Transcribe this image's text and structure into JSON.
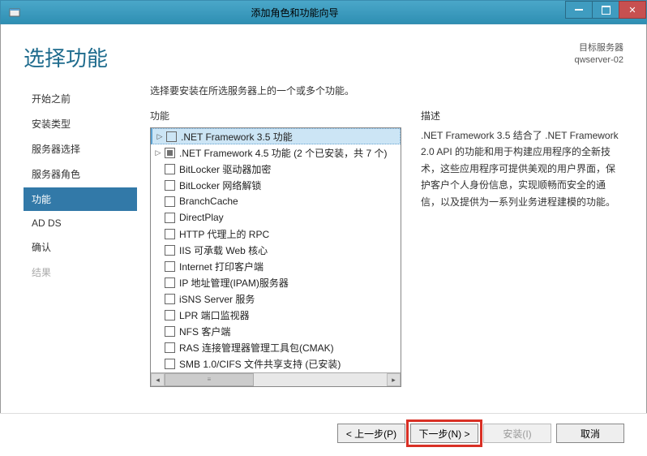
{
  "titlebar": {
    "title": "添加角色和功能向导"
  },
  "header": {
    "page_title": "选择功能",
    "server_label": "目标服务器",
    "server_name": "qwserver-02"
  },
  "nav": {
    "items": [
      {
        "label": "开始之前",
        "state": "normal"
      },
      {
        "label": "安装类型",
        "state": "normal"
      },
      {
        "label": "服务器选择",
        "state": "normal"
      },
      {
        "label": "服务器角色",
        "state": "normal"
      },
      {
        "label": "功能",
        "state": "active"
      },
      {
        "label": "AD DS",
        "state": "normal"
      },
      {
        "label": "确认",
        "state": "normal"
      },
      {
        "label": "结果",
        "state": "disabled"
      }
    ]
  },
  "instruction": "选择要安装在所选服务器上的一个或多个功能。",
  "features_label": "功能",
  "desc_label": "描述",
  "features": [
    {
      "label": ".NET Framework 3.5 功能",
      "expander": "▷",
      "checked": "none",
      "selected": true
    },
    {
      "label": ".NET Framework 4.5 功能 (2 个已安装，共 7 个)",
      "expander": "▷",
      "checked": "partial",
      "selected": false
    },
    {
      "label": "BitLocker 驱动器加密",
      "expander": "",
      "checked": "none",
      "selected": false
    },
    {
      "label": "BitLocker 网络解锁",
      "expander": "",
      "checked": "none",
      "selected": false
    },
    {
      "label": "BranchCache",
      "expander": "",
      "checked": "none",
      "selected": false
    },
    {
      "label": "DirectPlay",
      "expander": "",
      "checked": "none",
      "selected": false
    },
    {
      "label": "HTTP 代理上的 RPC",
      "expander": "",
      "checked": "none",
      "selected": false
    },
    {
      "label": "IIS 可承载 Web 核心",
      "expander": "",
      "checked": "none",
      "selected": false
    },
    {
      "label": "Internet 打印客户端",
      "expander": "",
      "checked": "none",
      "selected": false
    },
    {
      "label": "IP 地址管理(IPAM)服务器",
      "expander": "",
      "checked": "none",
      "selected": false
    },
    {
      "label": "iSNS Server 服务",
      "expander": "",
      "checked": "none",
      "selected": false
    },
    {
      "label": "LPR 端口监视器",
      "expander": "",
      "checked": "none",
      "selected": false
    },
    {
      "label": "NFS 客户端",
      "expander": "",
      "checked": "none",
      "selected": false
    },
    {
      "label": "RAS 连接管理器管理工具包(CMAK)",
      "expander": "",
      "checked": "none",
      "selected": false
    },
    {
      "label": "SMB 1.0/CIFS 文件共享支持 (已安装)",
      "expander": "",
      "checked": "none",
      "selected": false
    }
  ],
  "description": ".NET Framework 3.5 结合了 .NET Framework 2.0 API 的功能和用于构建应用程序的全新技术，这些应用程序可提供美观的用户界面，保护客户个人身份信息，实现顺畅而安全的通信，以及提供为一系列业务进程建模的功能。",
  "footer": {
    "prev": "< 上一步(P)",
    "next": "下一步(N) >",
    "install": "安装(I)",
    "cancel": "取消"
  }
}
